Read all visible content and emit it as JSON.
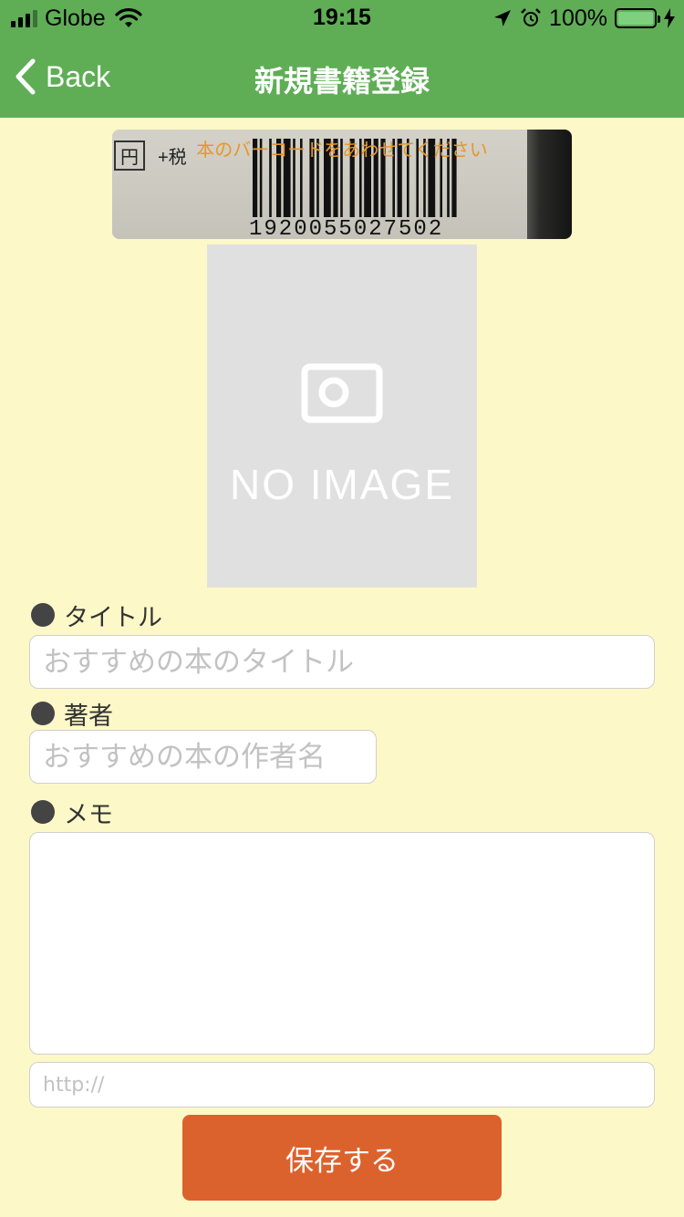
{
  "status_bar": {
    "carrier": "Globe",
    "time": "19:15",
    "battery_percent": "100%",
    "battery_level": 1.0,
    "icons": [
      "signal-icon",
      "wifi-icon",
      "location-icon",
      "alarm-icon",
      "battery-icon",
      "charging-icon"
    ]
  },
  "nav": {
    "back_label": "Back",
    "title": "新規書籍登録"
  },
  "scanner": {
    "hint": "本のバーコードをあわせてください",
    "tag_left": "円",
    "tag_right": "+税",
    "barcode_number": "1920055027502"
  },
  "cover": {
    "placeholder_text": "NO IMAGE"
  },
  "form": {
    "title_label": "タイトル",
    "title_placeholder": "おすすめの本のタイトル",
    "author_label": "著者",
    "author_placeholder": "おすすめの本の作者名",
    "memo_label": "メモ",
    "memo_value": "",
    "url_placeholder": "http://",
    "save_label": "保存する"
  },
  "colors": {
    "header": "#5fae56",
    "background": "#fdf8c8",
    "accent_button": "#dc622d",
    "scan_hint": "#e8962a"
  }
}
